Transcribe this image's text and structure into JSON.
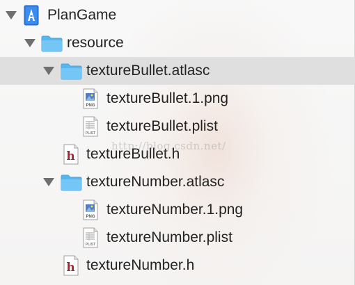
{
  "navigator": {
    "items": [
      {
        "label": "PlanGame",
        "icon": "xcode-project-icon",
        "expanded": true,
        "selected": false
      },
      {
        "label": "resource",
        "icon": "folder-icon",
        "expanded": true,
        "selected": false
      },
      {
        "label": "textureBullet.atlasc",
        "icon": "folder-icon",
        "expanded": true,
        "selected": true
      },
      {
        "label": "textureBullet.1.png",
        "icon": "png-file-icon",
        "selected": false
      },
      {
        "label": "textureBullet.plist",
        "icon": "plist-file-icon",
        "selected": false
      },
      {
        "label": "textureBullet.h",
        "icon": "header-file-icon",
        "selected": false
      },
      {
        "label": "textureNumber.atlasc",
        "icon": "folder-icon",
        "expanded": true,
        "selected": false
      },
      {
        "label": "textureNumber.1.png",
        "icon": "png-file-icon",
        "selected": false
      },
      {
        "label": "textureNumber.plist",
        "icon": "plist-file-icon",
        "selected": false
      },
      {
        "label": "textureNumber.h",
        "icon": "header-file-icon",
        "selected": false
      }
    ]
  },
  "icon_text": {
    "png": "PNG",
    "plist": "PLIST",
    "header": "h"
  },
  "watermark": {
    "text": "http://blog.csdn.net/"
  },
  "colors": {
    "selection": "#dfdfdf",
    "folder": "#58b6ee",
    "project": "#2f7ee6",
    "header_letter": "#a6272d",
    "text": "#232323"
  }
}
